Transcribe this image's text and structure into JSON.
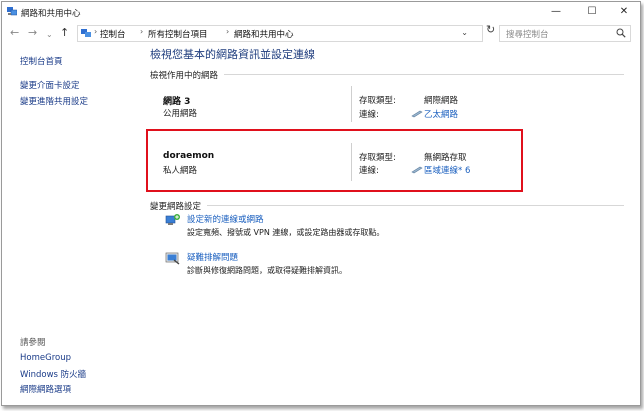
{
  "window": {
    "title": "網路和共用中心",
    "minimize_glyph": "—",
    "maximize_glyph": "☐",
    "close_glyph": "✕"
  },
  "nav": {
    "back_icon": "back-arrow-icon",
    "forward_icon": "forward-arrow-icon",
    "recent_icon": "chevron-down-icon",
    "up_icon": "up-arrow-icon"
  },
  "address": {
    "crumbs": [
      "控制台",
      "所有控制台項目",
      "網路和共用中心"
    ],
    "refresh_glyph": "↻"
  },
  "search": {
    "placeholder": "搜尋控制台"
  },
  "sidebar": {
    "links": [
      "控制台首頁",
      "變更介面卡設定",
      "變更進階共用設定"
    ],
    "see_also_header": "請參閱",
    "see_also": [
      "HomeGroup",
      "Windows 防火牆",
      "網際網路選項"
    ]
  },
  "main": {
    "title": "檢視您基本的網路資訊並設定連線",
    "active_networks_header": "檢視作用中的網路",
    "networks": [
      {
        "name": "網路  3",
        "category": "公用網路",
        "access_label": "存取類型:",
        "access_value": "網際網路",
        "conn_label": "連線:",
        "conn_value": "乙太網路",
        "conn_icon": "ethernet-icon"
      },
      {
        "name": "doraemon",
        "category": "私人網路",
        "access_label": "存取類型:",
        "access_value": "無網路存取",
        "conn_label": "連線:",
        "conn_value": "區域連線* 6",
        "conn_icon": "network-adapter-icon"
      }
    ],
    "change_settings_header": "變更網路設定",
    "tasks": [
      {
        "title": "設定新的連線或網路",
        "desc": "設定寬頻、撥號或 VPN 連線，或設定路由器或存取點。",
        "icon": "new-connection-icon"
      },
      {
        "title": "疑難排解問題",
        "desc": "診斷與修復網路問題，或取得疑難排解資訊。",
        "icon": "troubleshoot-icon"
      }
    ]
  },
  "colors": {
    "link": "#1a5fbf",
    "title": "#1e3c7d",
    "highlight": "#e0101c"
  }
}
